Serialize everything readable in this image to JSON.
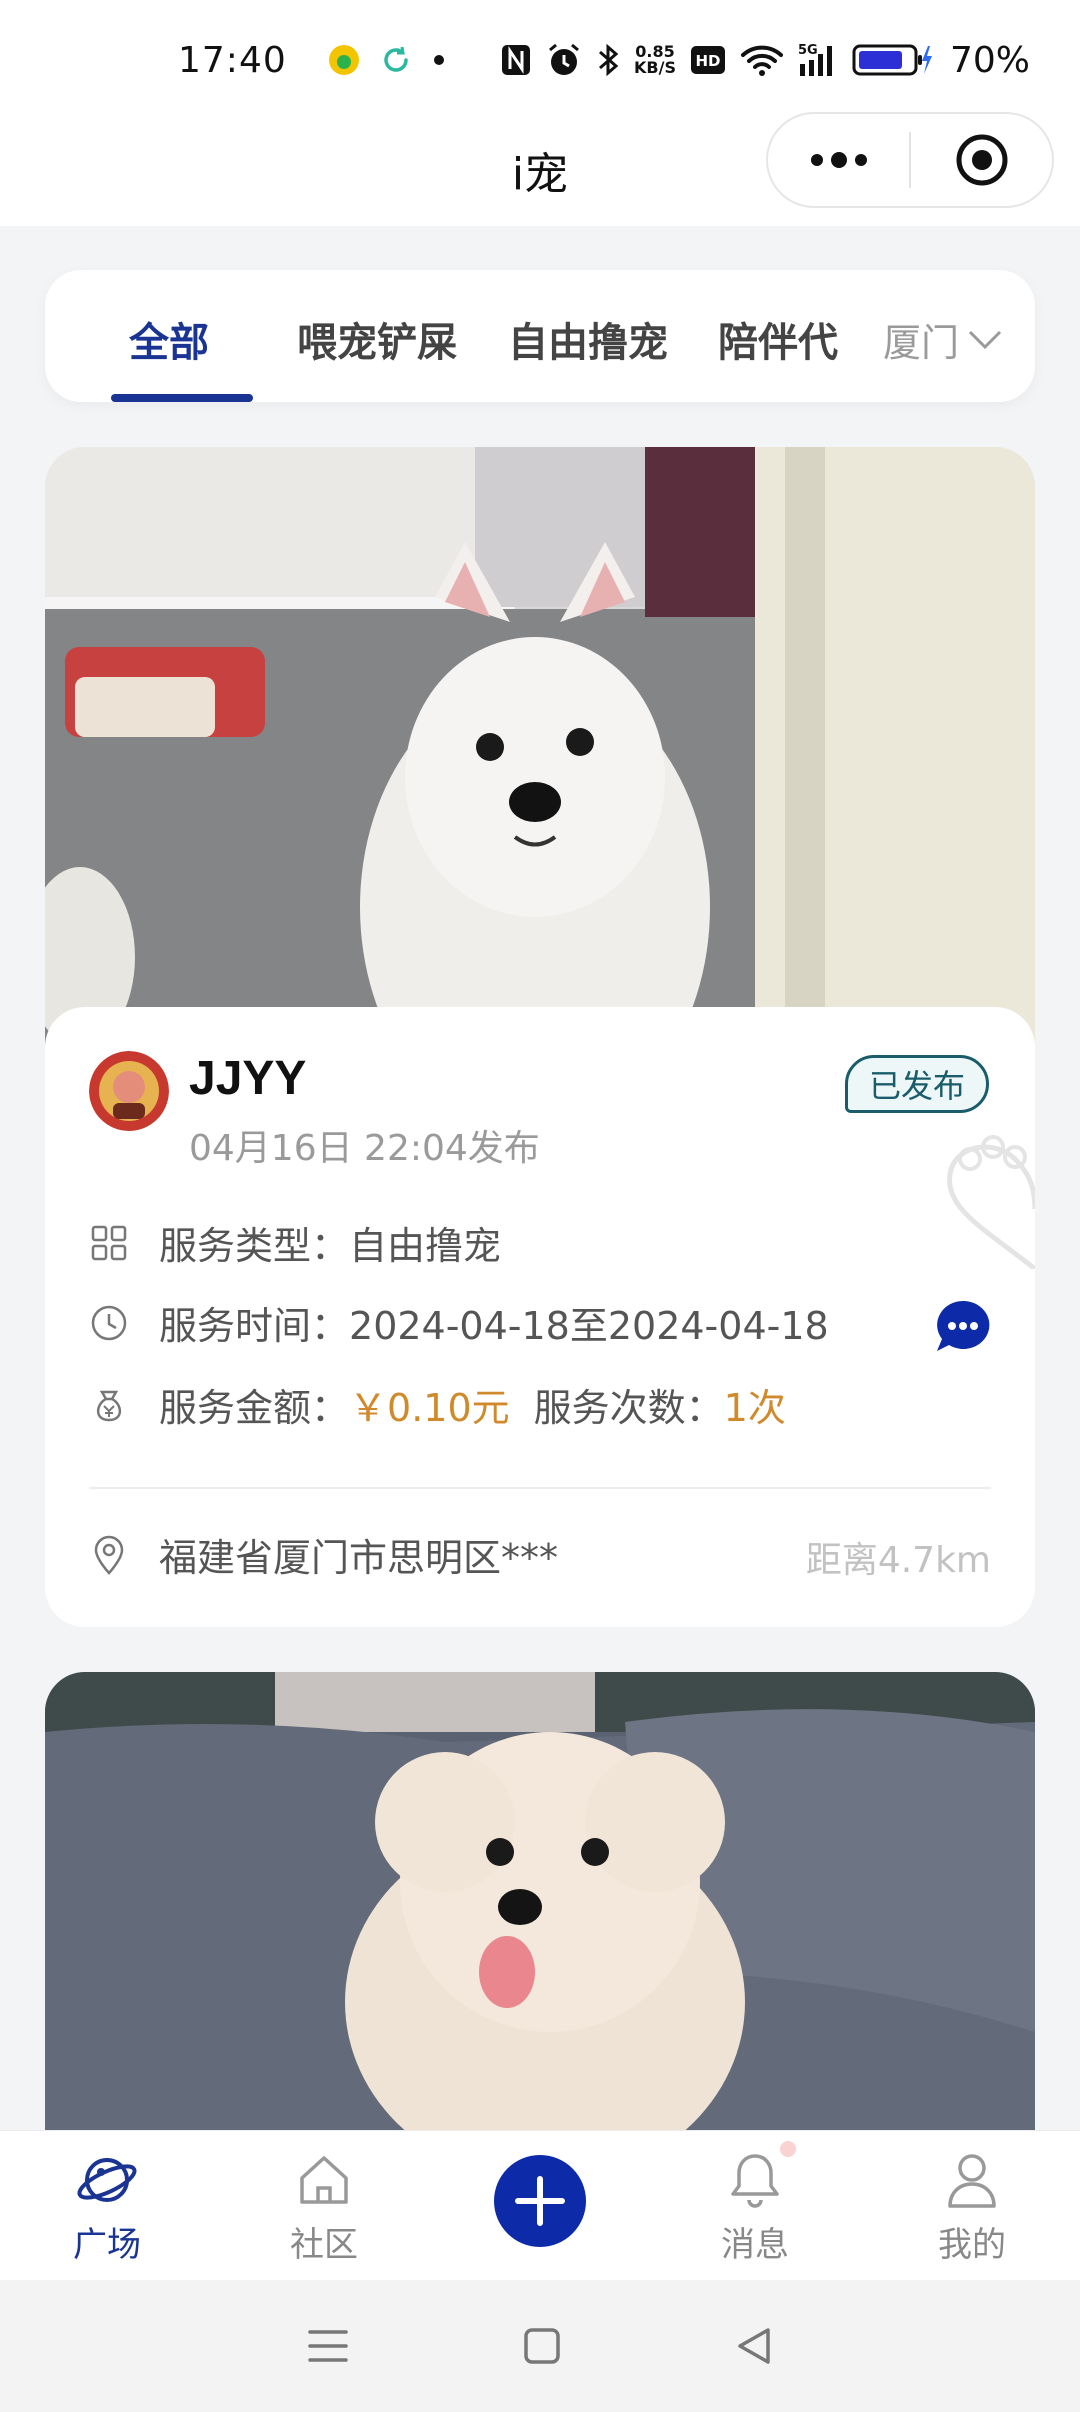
{
  "status_bar": {
    "time": "17:40",
    "net_speed_value": "0.85",
    "net_speed_unit": "KB/S",
    "hd": "HD",
    "signal": "5G",
    "battery": "70%"
  },
  "title_bar": {
    "title": "i宠"
  },
  "tabs": {
    "items": [
      {
        "label": "全部",
        "active": true
      },
      {
        "label": "喂宠铲屎",
        "active": false
      },
      {
        "label": "自由撸宠",
        "active": false
      },
      {
        "label": "陪伴代",
        "active": false
      }
    ],
    "city": "厦门"
  },
  "post": {
    "username": "JJYY",
    "published_at": "04月16日 22:04发布",
    "status": "已发布",
    "service_type_label": "服务类型：",
    "service_type_value": "自由撸宠",
    "service_time_label": "服务时间：",
    "service_time_value": "2024-04-18至2024-04-18",
    "amount_label": "服务金额：",
    "amount_value": "￥0.10元",
    "count_label": "服务次数：",
    "count_value": "1次",
    "address": "福建省厦门市思明区***",
    "distance": "距离4.7km"
  },
  "bottom_nav": {
    "items": [
      {
        "label": "广场",
        "icon": "planet-icon",
        "active": true
      },
      {
        "label": "社区",
        "icon": "home-icon",
        "active": false
      },
      {
        "label": "",
        "icon": "plus-icon",
        "active": false
      },
      {
        "label": "消息",
        "icon": "bell-icon",
        "active": false
      },
      {
        "label": "我的",
        "icon": "user-icon",
        "active": false
      }
    ]
  },
  "colors": {
    "accent": "#1a3494",
    "price": "#d08a2c",
    "badge": "#1a5c6a"
  }
}
